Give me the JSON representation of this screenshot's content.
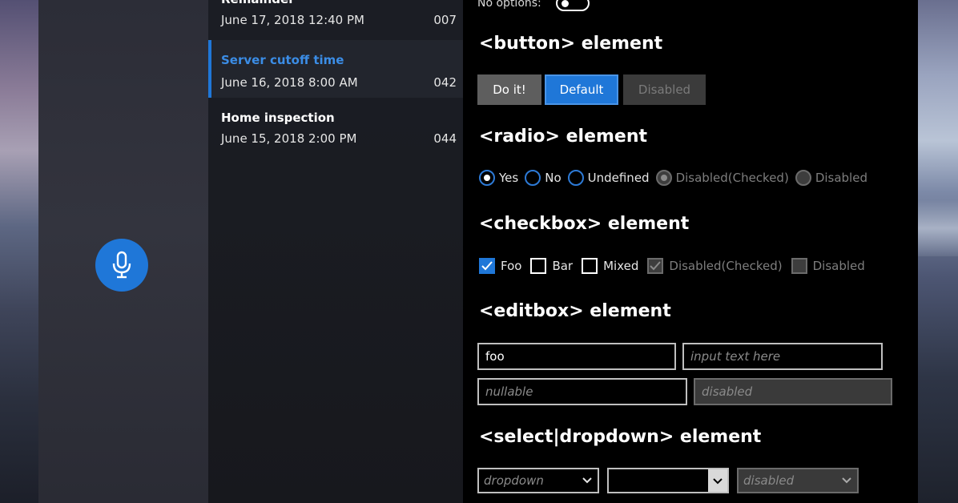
{
  "list": {
    "items": [
      {
        "title": "Remainder",
        "date": "June 17, 2018  12:40 PM",
        "code": "007"
      },
      {
        "title": "Server cutoff time",
        "date": "June 16, 2018  8:00 AM",
        "code": "042"
      },
      {
        "title": "Home inspection",
        "date": "June 15, 2018  2:00 PM",
        "code": "044"
      }
    ]
  },
  "content": {
    "toggle_label": "No options:",
    "button_section": {
      "title": "<button> element",
      "buttons": [
        "Do it!",
        "Default",
        "Disabled"
      ]
    },
    "radio_section": {
      "title": "<radio> element",
      "options": [
        "Yes",
        "No",
        "Undefined",
        "Disabled(Checked)",
        "Disabled"
      ]
    },
    "checkbox_section": {
      "title": "<checkbox> element",
      "options": [
        "Foo",
        "Bar",
        "Mixed",
        "Disabled(Checked)",
        "Disabled"
      ]
    },
    "editbox_section": {
      "title": "<editbox> element",
      "field1_value": "foo",
      "field2_placeholder": "input text here",
      "field3_placeholder": "nullable",
      "field4_placeholder": "disabled"
    },
    "select_section": {
      "title": "<select|dropdown> element",
      "select1_value": "dropdown",
      "select2_value": "",
      "select3_value": "disabled"
    }
  },
  "colors": {
    "accent": "#1f77d8",
    "background": "#000000"
  }
}
